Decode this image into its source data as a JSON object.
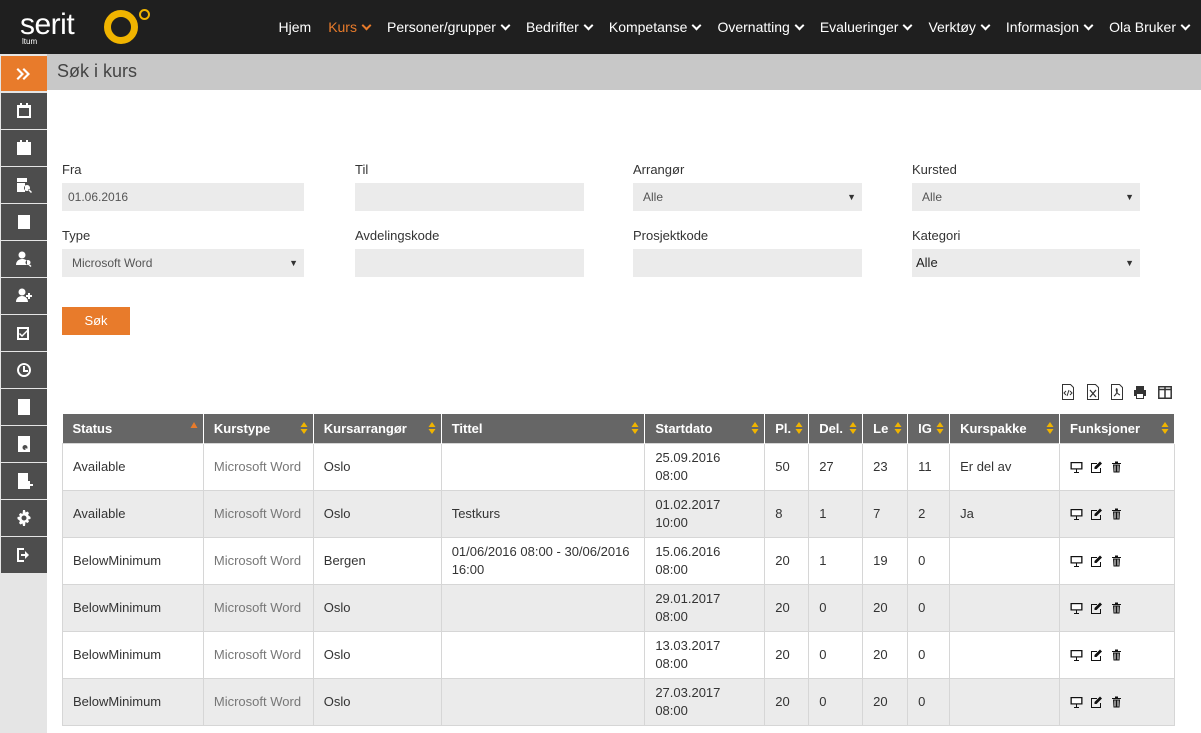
{
  "app": {
    "logo_text": "serit",
    "logo_sub": "ltum",
    "accent": "#e87b2b"
  },
  "nav": [
    {
      "label": "Hjem",
      "dropdown": false,
      "active": false
    },
    {
      "label": "Kurs",
      "dropdown": true,
      "active": true
    },
    {
      "label": "Personer/grupper",
      "dropdown": true,
      "active": false
    },
    {
      "label": "Bedrifter",
      "dropdown": true,
      "active": false
    },
    {
      "label": "Kompetanse",
      "dropdown": true,
      "active": false
    },
    {
      "label": "Overnatting",
      "dropdown": true,
      "active": false
    },
    {
      "label": "Evalueringer",
      "dropdown": true,
      "active": false
    },
    {
      "label": "Verktøy",
      "dropdown": true,
      "active": false
    },
    {
      "label": "Informasjon",
      "dropdown": true,
      "active": false
    },
    {
      "label": "Ola Bruker",
      "dropdown": true,
      "active": false
    }
  ],
  "page": {
    "title": "Søk i kurs"
  },
  "form": {
    "fra_label": "Fra",
    "fra_value": "01.06.2016",
    "til_label": "Til",
    "til_value": "",
    "arrangor_label": "Arrangør",
    "arrangor_value": "Alle",
    "kursted_label": "Kursted",
    "kursted_value": "Alle",
    "type_label": "Type",
    "type_value": "Microsoft Word",
    "avdelingskode_label": "Avdelingskode",
    "avdelingskode_value": "",
    "prosjektkode_label": "Prosjektkode",
    "prosjektkode_value": "",
    "kategori_label": "Kategori",
    "kategori_value": "Alle",
    "search_label": "Søk"
  },
  "table": {
    "headers": [
      "Status",
      "Kurstype",
      "Kursarrangør",
      "Tittel",
      "Startdato",
      "Pl.",
      "Del.",
      "Le",
      "IG",
      "Kurspakke",
      "Funksjoner"
    ],
    "rows": [
      {
        "status": "Available",
        "kurstype": "Microsoft Word",
        "arrangor": "Oslo",
        "tittel": "",
        "startdato": "25.09.2016 08:00",
        "pl": "50",
        "del": "27",
        "le": "23",
        "ig": "11",
        "kurspakke": "Er del av"
      },
      {
        "status": "Available",
        "kurstype": "Microsoft Word",
        "arrangor": "Oslo",
        "tittel": "Testkurs",
        "startdato": "01.02.2017 10:00",
        "pl": "8",
        "del": "1",
        "le": "7",
        "ig": "2",
        "kurspakke": "Ja"
      },
      {
        "status": "BelowMinimum",
        "kurstype": "Microsoft Word",
        "arrangor": "Bergen",
        "tittel": "01/06/2016 08:00 - 30/06/2016 16:00",
        "startdato": "15.06.2016 08:00",
        "pl": "20",
        "del": "1",
        "le": "19",
        "ig": "0",
        "kurspakke": ""
      },
      {
        "status": "BelowMinimum",
        "kurstype": "Microsoft Word",
        "arrangor": "Oslo",
        "tittel": "",
        "startdato": "29.01.2017 08:00",
        "pl": "20",
        "del": "0",
        "le": "20",
        "ig": "0",
        "kurspakke": ""
      },
      {
        "status": "BelowMinimum",
        "kurstype": "Microsoft Word",
        "arrangor": "Oslo",
        "tittel": "",
        "startdato": "13.03.2017 08:00",
        "pl": "20",
        "del": "0",
        "le": "20",
        "ig": "0",
        "kurspakke": ""
      },
      {
        "status": "BelowMinimum",
        "kurstype": "Microsoft Word",
        "arrangor": "Oslo",
        "tittel": "",
        "startdato": "27.03.2017 08:00",
        "pl": "20",
        "del": "0",
        "le": "20",
        "ig": "0",
        "kurspakke": ""
      }
    ]
  },
  "sidebar_icons": [
    "expand-icon",
    "calendar-icon",
    "calendar-grid-icon",
    "search-course-icon",
    "course-list-icon",
    "user-search-icon",
    "add-user-icon",
    "checkbox-icon",
    "clock-icon",
    "document-icon",
    "document-search-icon",
    "document-add-icon",
    "gear-icon",
    "logout-icon"
  ],
  "export_icons": [
    "code-export-icon",
    "excel-export-icon",
    "pdf-export-icon",
    "print-icon",
    "columns-icon"
  ]
}
